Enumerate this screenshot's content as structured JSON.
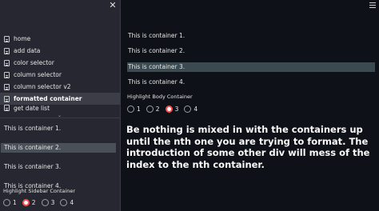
{
  "sidebar": {
    "close_icon": "close-icon",
    "nav_items": [
      {
        "label": "home",
        "active": false
      },
      {
        "label": "add data",
        "active": false
      },
      {
        "label": "color selector",
        "active": false
      },
      {
        "label": "column selector",
        "active": false
      },
      {
        "label": "column selector v2",
        "active": false
      },
      {
        "label": "formatted container",
        "active": true
      },
      {
        "label": "get date list",
        "active": false
      }
    ],
    "containers": [
      {
        "text": "This is container 1.",
        "highlighted": false
      },
      {
        "text": "This is container 2.",
        "highlighted": true
      },
      {
        "text": "This is container 3.",
        "highlighted": false
      },
      {
        "text": "This is container 4.",
        "highlighted": false
      }
    ],
    "radio_label": "Highlight Sidebar Container",
    "radio_options": [
      "1",
      "2",
      "3",
      "4"
    ],
    "radio_selected": "2"
  },
  "main": {
    "containers": [
      {
        "text": "This is container 1.",
        "highlighted": false
      },
      {
        "text": "This is container 2.",
        "highlighted": false
      },
      {
        "text": "This is container 3.",
        "highlighted": true
      },
      {
        "text": "This is container 4.",
        "highlighted": false
      }
    ],
    "radio_label": "Highlight Body Container",
    "radio_options": [
      "1",
      "2",
      "3",
      "4"
    ],
    "radio_selected": "3",
    "message": "Be nothing is mixed in with the containers up until the nth one you are trying to format. The introduction of some other div will mess of the index to the nth container."
  },
  "colors": {
    "background": "#0e1117",
    "sidebar_bg": "#262730",
    "accent": "#ff4b4b"
  }
}
